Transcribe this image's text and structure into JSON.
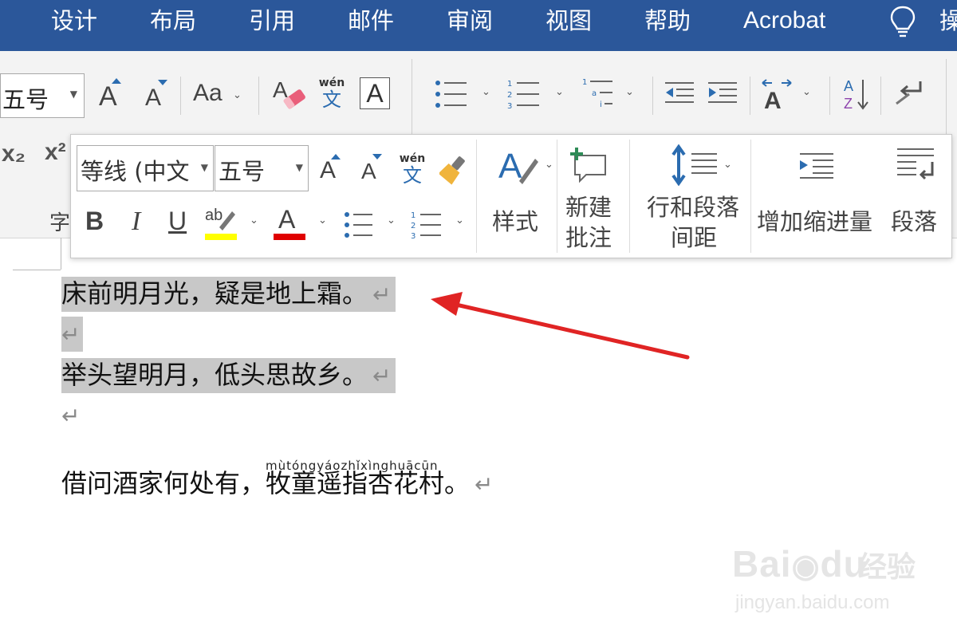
{
  "colors": {
    "tabbar": "#2b579a",
    "ribbon": "#f3f3f3",
    "selection": "#c8c8c8",
    "arrow": "#e02424",
    "highlight_yellow": "#ffff00",
    "font_red": "#e00000",
    "accent_blue": "#2b6cb0"
  },
  "tabs": [
    "设计",
    "布局",
    "引用",
    "邮件",
    "审阅",
    "视图",
    "帮助",
    "Acrobat"
  ],
  "tab_overflow": "操",
  "ribbon": {
    "font_size_value": "五号",
    "change_case_label": "Aa",
    "phonetic_top": "wén",
    "phonetic_bottom": "文",
    "char_border_label": "A",
    "subscript_label": "x₂",
    "superscript_label": "x²",
    "group_label": "字"
  },
  "mini_toolbar": {
    "font_name": "等线 (中文",
    "font_size": "五号",
    "phonetic_top": "wén",
    "phonetic_bottom": "文",
    "bold": "B",
    "italic": "I",
    "underline": "U",
    "highlight": "ab",
    "font_color": "A",
    "styles_label": "样式",
    "new_comment_line1": "新建",
    "new_comment_line2": "批注",
    "line_spacing_line1": "行和段落",
    "line_spacing_line2": "间距",
    "increase_indent": "增加缩进量",
    "paragraph": "段落"
  },
  "document": {
    "line1": "床前明月光，疑是地上霜。",
    "line2": "举头望明月，低头思故乡。",
    "line3_pre": "借问酒家何处有，",
    "line3_ruby_base": "牧童遥指杏花村",
    "line3_ruby_text": "mùtóngyáozhǐxìnghuācūn",
    "line3_post": "。",
    "paragraph_mark": "↵"
  },
  "watermark": {
    "brand": "Bai",
    "brand2": "du",
    "brand_cn": "经验",
    "url": "jingyan.baidu.com"
  }
}
